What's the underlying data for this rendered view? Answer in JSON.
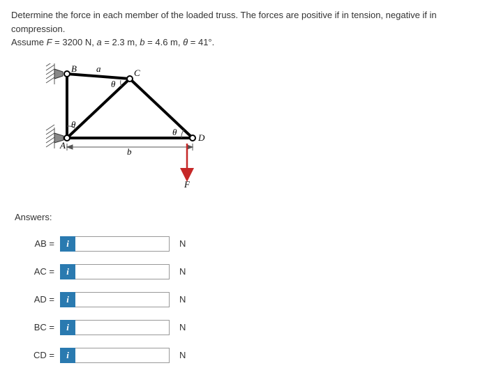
{
  "problem": {
    "line1": "Determine the force in each member of the loaded truss. The forces are positive if in tension, negative if in compression.",
    "line2_prefix": "Assume ",
    "F_var": "F",
    "F_val": " = 3200 N, ",
    "a_var": "a",
    "a_val": " = 2.3 m, ",
    "b_var": "b",
    "b_val": " = 4.6 m, ",
    "theta_var": "θ",
    "theta_val": " = 41°."
  },
  "diagram": {
    "labels": {
      "A": "A",
      "B": "B",
      "C": "C",
      "D": "D",
      "F": "F",
      "a": "a",
      "b": "b",
      "theta1": "θ",
      "theta2": "θ",
      "theta3": "θ"
    }
  },
  "answers_header": "Answers:",
  "answers": [
    {
      "label": "AB =",
      "unit": "N"
    },
    {
      "label": "AC =",
      "unit": "N"
    },
    {
      "label": "AD =",
      "unit": "N"
    },
    {
      "label": "BC =",
      "unit": "N"
    },
    {
      "label": "CD =",
      "unit": "N"
    }
  ],
  "info_icon_glyph": "i"
}
